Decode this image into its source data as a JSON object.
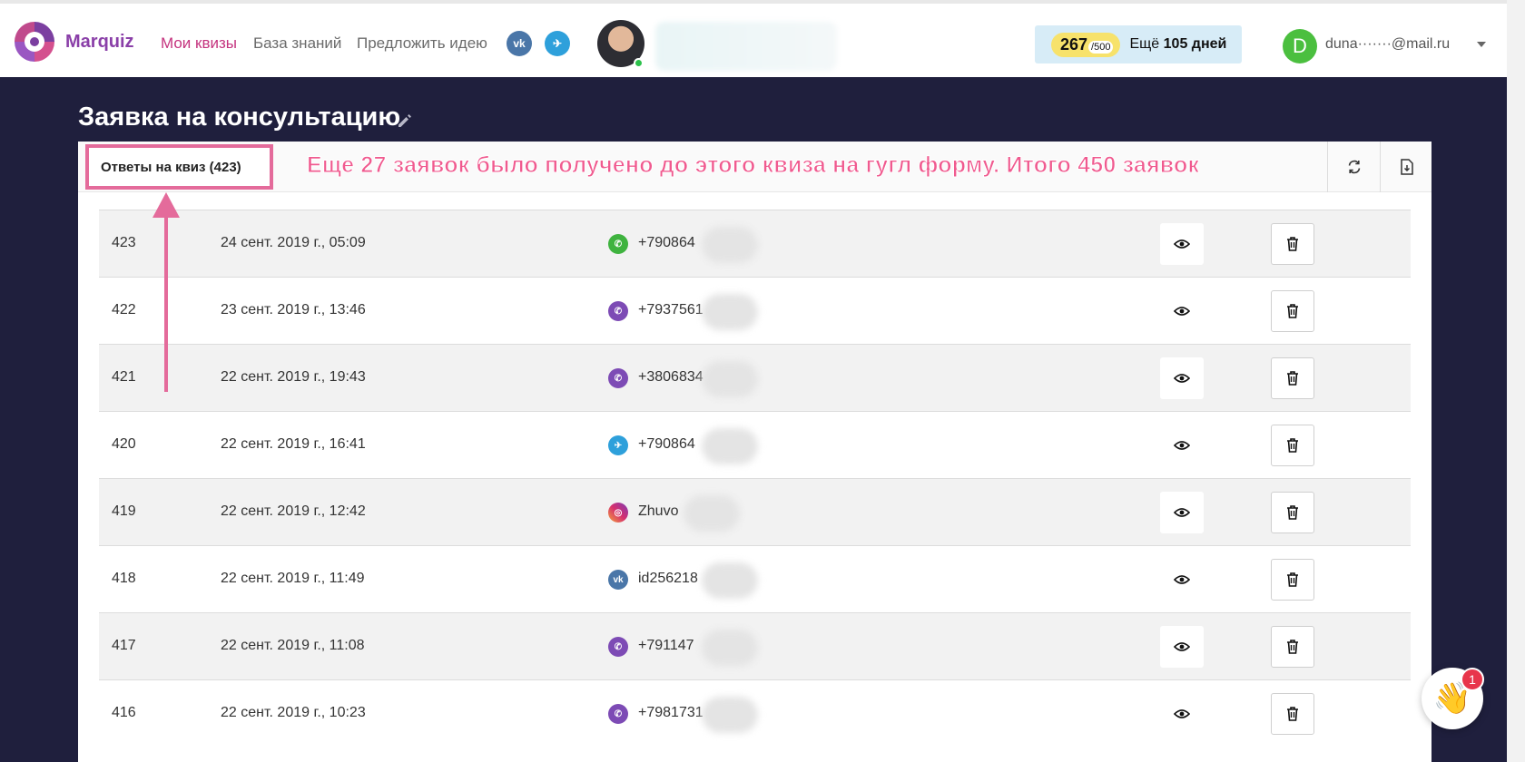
{
  "header": {
    "logo_text": "Marquiz",
    "nav": [
      "Мои квизы",
      "База знаний",
      "Предложить идею"
    ],
    "social": [
      {
        "name": "vk",
        "label": "vk"
      },
      {
        "name": "telegram",
        "label": "✈"
      }
    ],
    "limit": {
      "count": "267",
      "max": "/500",
      "days_prefix": "Ещё ",
      "days_value": "105 дней"
    },
    "user": {
      "initial": "D",
      "email": "duna·······@mail.ru"
    }
  },
  "page": {
    "title": "Заявка на консультацию",
    "tab_label": "Ответы на квиз (423)",
    "annotation": "Еще 27 заявок было получено до этого квиза на гугл форму. Итого 450 заявок"
  },
  "rows": [
    {
      "id": "423",
      "date": "24 сент. 2019 г., 05:09",
      "channel": "whatsapp",
      "contact": "+790864"
    },
    {
      "id": "422",
      "date": "23 сент. 2019 г., 13:46",
      "channel": "viber",
      "contact": "+7937561"
    },
    {
      "id": "421",
      "date": "22 сент. 2019 г., 19:43",
      "channel": "viber",
      "contact": "+3806834"
    },
    {
      "id": "420",
      "date": "22 сент. 2019 г., 16:41",
      "channel": "telegram",
      "contact": "+790864"
    },
    {
      "id": "419",
      "date": "22 сент. 2019 г., 12:42",
      "channel": "instagram",
      "contact": "Zhuvo"
    },
    {
      "id": "418",
      "date": "22 сент. 2019 г., 11:49",
      "channel": "vk",
      "contact": "id256218"
    },
    {
      "id": "417",
      "date": "22 сент. 2019 г., 11:08",
      "channel": "viber",
      "contact": "+791147"
    },
    {
      "id": "416",
      "date": "22 сент. 2019 г., 10:23",
      "channel": "viber",
      "contact": "+7981731"
    }
  ],
  "chat": {
    "badge": "1",
    "icon": "waving-hand-icon"
  },
  "colors": {
    "accent": "#c4337e",
    "dark_bg": "#1f1f3d",
    "annotation": "#f05a8f"
  }
}
